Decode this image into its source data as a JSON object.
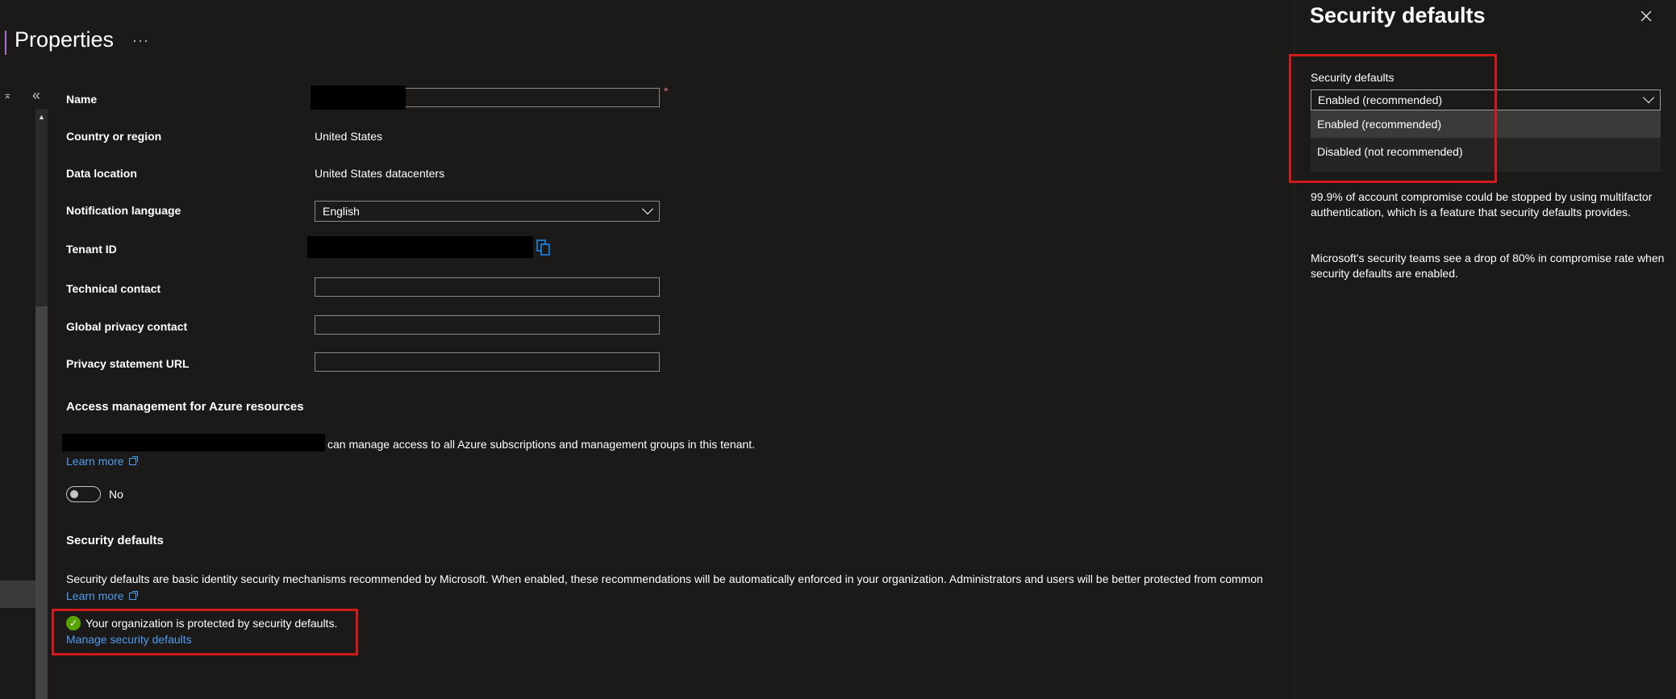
{
  "header": {
    "title": "Properties",
    "more_label": "···"
  },
  "form": {
    "name": {
      "label": "Name",
      "required_marker": "*"
    },
    "country": {
      "label": "Country or region",
      "value": "United States"
    },
    "data_location": {
      "label": "Data location",
      "value": "United States datacenters"
    },
    "notification_language": {
      "label": "Notification language",
      "value": "English"
    },
    "tenant_id": {
      "label": "Tenant ID"
    },
    "technical_contact": {
      "label": "Technical contact"
    },
    "global_privacy_contact": {
      "label": "Global privacy contact"
    },
    "privacy_statement_url": {
      "label": "Privacy statement URL"
    }
  },
  "access_management": {
    "heading": "Access management for Azure resources",
    "description": "can manage access to all Azure subscriptions and management groups in this tenant.",
    "learn_more": "Learn more",
    "toggle_label": "No"
  },
  "security_defaults": {
    "heading": "Security defaults",
    "description": "Security defaults are basic identity security mechanisms recommended by Microsoft. When enabled, these recommendations will be automatically enforced in your organization. Administrators and users will be better protected from common",
    "learn_more": "Learn more",
    "status": "Your organization is protected by security defaults.",
    "manage_link": "Manage security defaults"
  },
  "panel": {
    "title": "Security defaults",
    "field_label": "Security defaults",
    "selected_value": "Enabled (recommended)",
    "options": [
      "Enabled (recommended)",
      "Disabled (not recommended)"
    ],
    "paragraph1": "99.9% of account compromise could be stopped by using multifactor authentication, which is a feature that security defaults provides.",
    "paragraph2": "Microsoft's security teams see a drop of 80% in compromise rate when security defaults are enabled."
  },
  "colors": {
    "background": "#1b1a19",
    "link": "#4f9cf0",
    "highlight_border": "#d11a1a",
    "success": "#57a300"
  }
}
